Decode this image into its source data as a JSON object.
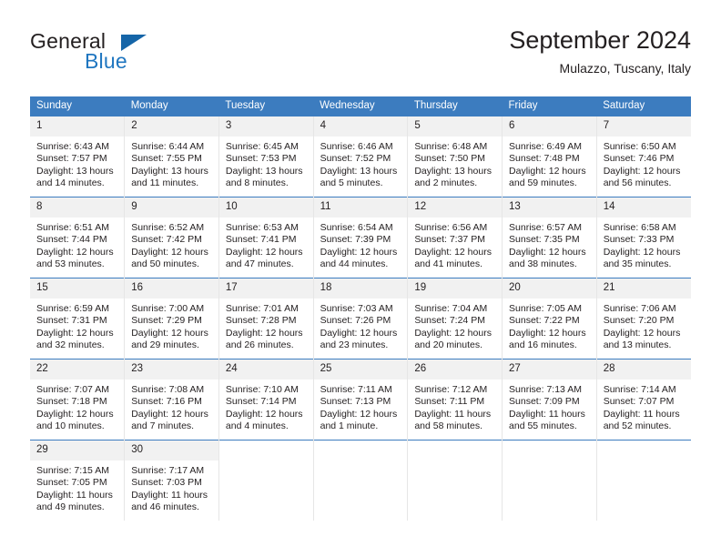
{
  "brand": {
    "word_one": "General",
    "word_two": "Blue",
    "icon": "triangle-logo-icon"
  },
  "header": {
    "title": "September 2024",
    "subtitle": "Mulazzo, Tuscany, Italy"
  },
  "colors": {
    "header_blue": "#3c7cbf",
    "brand_blue": "#1f76c0",
    "daynum_gray": "#f1f1f1",
    "text": "#231f20"
  },
  "labels": {
    "sunrise_prefix": "Sunrise:",
    "sunset_prefix": "Sunset:",
    "daylight_prefix": "Daylight:"
  },
  "weekdays": [
    "Sunday",
    "Monday",
    "Tuesday",
    "Wednesday",
    "Thursday",
    "Friday",
    "Saturday"
  ],
  "weeks": [
    [
      {
        "day": "1",
        "sunrise": "Sunrise: 6:43 AM",
        "sunset": "Sunset: 7:57 PM",
        "daylight": "Daylight: 13 hours and 14 minutes."
      },
      {
        "day": "2",
        "sunrise": "Sunrise: 6:44 AM",
        "sunset": "Sunset: 7:55 PM",
        "daylight": "Daylight: 13 hours and 11 minutes."
      },
      {
        "day": "3",
        "sunrise": "Sunrise: 6:45 AM",
        "sunset": "Sunset: 7:53 PM",
        "daylight": "Daylight: 13 hours and 8 minutes."
      },
      {
        "day": "4",
        "sunrise": "Sunrise: 6:46 AM",
        "sunset": "Sunset: 7:52 PM",
        "daylight": "Daylight: 13 hours and 5 minutes."
      },
      {
        "day": "5",
        "sunrise": "Sunrise: 6:48 AM",
        "sunset": "Sunset: 7:50 PM",
        "daylight": "Daylight: 13 hours and 2 minutes."
      },
      {
        "day": "6",
        "sunrise": "Sunrise: 6:49 AM",
        "sunset": "Sunset: 7:48 PM",
        "daylight": "Daylight: 12 hours and 59 minutes."
      },
      {
        "day": "7",
        "sunrise": "Sunrise: 6:50 AM",
        "sunset": "Sunset: 7:46 PM",
        "daylight": "Daylight: 12 hours and 56 minutes."
      }
    ],
    [
      {
        "day": "8",
        "sunrise": "Sunrise: 6:51 AM",
        "sunset": "Sunset: 7:44 PM",
        "daylight": "Daylight: 12 hours and 53 minutes."
      },
      {
        "day": "9",
        "sunrise": "Sunrise: 6:52 AM",
        "sunset": "Sunset: 7:42 PM",
        "daylight": "Daylight: 12 hours and 50 minutes."
      },
      {
        "day": "10",
        "sunrise": "Sunrise: 6:53 AM",
        "sunset": "Sunset: 7:41 PM",
        "daylight": "Daylight: 12 hours and 47 minutes."
      },
      {
        "day": "11",
        "sunrise": "Sunrise: 6:54 AM",
        "sunset": "Sunset: 7:39 PM",
        "daylight": "Daylight: 12 hours and 44 minutes."
      },
      {
        "day": "12",
        "sunrise": "Sunrise: 6:56 AM",
        "sunset": "Sunset: 7:37 PM",
        "daylight": "Daylight: 12 hours and 41 minutes."
      },
      {
        "day": "13",
        "sunrise": "Sunrise: 6:57 AM",
        "sunset": "Sunset: 7:35 PM",
        "daylight": "Daylight: 12 hours and 38 minutes."
      },
      {
        "day": "14",
        "sunrise": "Sunrise: 6:58 AM",
        "sunset": "Sunset: 7:33 PM",
        "daylight": "Daylight: 12 hours and 35 minutes."
      }
    ],
    [
      {
        "day": "15",
        "sunrise": "Sunrise: 6:59 AM",
        "sunset": "Sunset: 7:31 PM",
        "daylight": "Daylight: 12 hours and 32 minutes."
      },
      {
        "day": "16",
        "sunrise": "Sunrise: 7:00 AM",
        "sunset": "Sunset: 7:29 PM",
        "daylight": "Daylight: 12 hours and 29 minutes."
      },
      {
        "day": "17",
        "sunrise": "Sunrise: 7:01 AM",
        "sunset": "Sunset: 7:28 PM",
        "daylight": "Daylight: 12 hours and 26 minutes."
      },
      {
        "day": "18",
        "sunrise": "Sunrise: 7:03 AM",
        "sunset": "Sunset: 7:26 PM",
        "daylight": "Daylight: 12 hours and 23 minutes."
      },
      {
        "day": "19",
        "sunrise": "Sunrise: 7:04 AM",
        "sunset": "Sunset: 7:24 PM",
        "daylight": "Daylight: 12 hours and 20 minutes."
      },
      {
        "day": "20",
        "sunrise": "Sunrise: 7:05 AM",
        "sunset": "Sunset: 7:22 PM",
        "daylight": "Daylight: 12 hours and 16 minutes."
      },
      {
        "day": "21",
        "sunrise": "Sunrise: 7:06 AM",
        "sunset": "Sunset: 7:20 PM",
        "daylight": "Daylight: 12 hours and 13 minutes."
      }
    ],
    [
      {
        "day": "22",
        "sunrise": "Sunrise: 7:07 AM",
        "sunset": "Sunset: 7:18 PM",
        "daylight": "Daylight: 12 hours and 10 minutes."
      },
      {
        "day": "23",
        "sunrise": "Sunrise: 7:08 AM",
        "sunset": "Sunset: 7:16 PM",
        "daylight": "Daylight: 12 hours and 7 minutes."
      },
      {
        "day": "24",
        "sunrise": "Sunrise: 7:10 AM",
        "sunset": "Sunset: 7:14 PM",
        "daylight": "Daylight: 12 hours and 4 minutes."
      },
      {
        "day": "25",
        "sunrise": "Sunrise: 7:11 AM",
        "sunset": "Sunset: 7:13 PM",
        "daylight": "Daylight: 12 hours and 1 minute."
      },
      {
        "day": "26",
        "sunrise": "Sunrise: 7:12 AM",
        "sunset": "Sunset: 7:11 PM",
        "daylight": "Daylight: 11 hours and 58 minutes."
      },
      {
        "day": "27",
        "sunrise": "Sunrise: 7:13 AM",
        "sunset": "Sunset: 7:09 PM",
        "daylight": "Daylight: 11 hours and 55 minutes."
      },
      {
        "day": "28",
        "sunrise": "Sunrise: 7:14 AM",
        "sunset": "Sunset: 7:07 PM",
        "daylight": "Daylight: 11 hours and 52 minutes."
      }
    ],
    [
      {
        "day": "29",
        "sunrise": "Sunrise: 7:15 AM",
        "sunset": "Sunset: 7:05 PM",
        "daylight": "Daylight: 11 hours and 49 minutes."
      },
      {
        "day": "30",
        "sunrise": "Sunrise: 7:17 AM",
        "sunset": "Sunset: 7:03 PM",
        "daylight": "Daylight: 11 hours and 46 minutes."
      },
      {
        "day": "",
        "sunrise": "",
        "sunset": "",
        "daylight": ""
      },
      {
        "day": "",
        "sunrise": "",
        "sunset": "",
        "daylight": ""
      },
      {
        "day": "",
        "sunrise": "",
        "sunset": "",
        "daylight": ""
      },
      {
        "day": "",
        "sunrise": "",
        "sunset": "",
        "daylight": ""
      },
      {
        "day": "",
        "sunrise": "",
        "sunset": "",
        "daylight": ""
      }
    ]
  ]
}
